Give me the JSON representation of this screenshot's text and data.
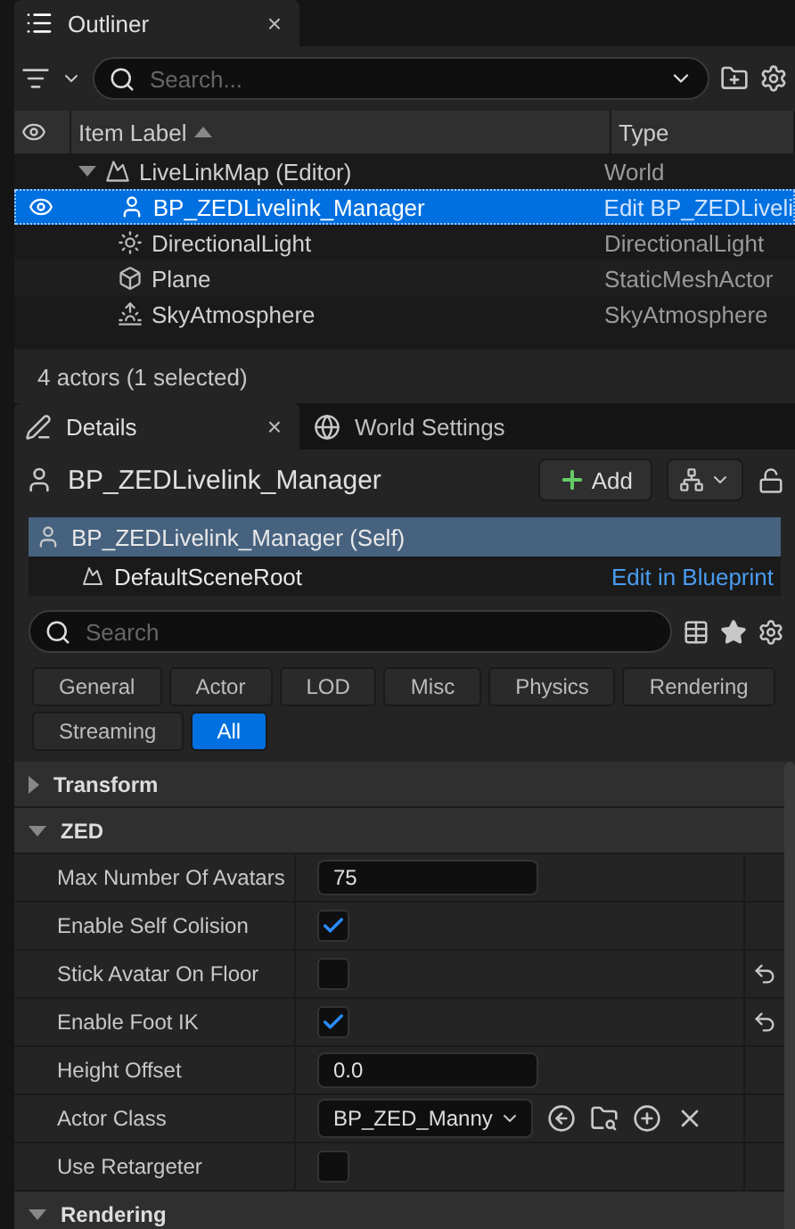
{
  "outliner": {
    "tab": {
      "title": "Outliner",
      "close": "×"
    },
    "search": {
      "placeholder": "Search..."
    },
    "columns": [
      {
        "label": "Item Label",
        "sorted": true
      },
      {
        "label": "Type",
        "sorted": false
      }
    ],
    "rows": [
      {
        "kind": "world",
        "label": "LiveLinkMap (Editor)",
        "type": "World",
        "expanded": true,
        "selected": false,
        "visible": false,
        "children": [
          {
            "kind": "actor",
            "label": "BP_ZEDLivelink_Manager",
            "type": "Edit BP_ZEDLiveli",
            "type_is_link": true,
            "selected": true,
            "visible": true
          },
          {
            "kind": "light",
            "label": "DirectionalLight",
            "type": "DirectionalLight",
            "type_is_link": false,
            "selected": false,
            "visible": false
          },
          {
            "kind": "mesh",
            "label": "Plane",
            "type": "StaticMeshActor",
            "type_is_link": false,
            "selected": false,
            "visible": false
          },
          {
            "kind": "sky",
            "label": "SkyAtmosphere",
            "type": "SkyAtmosphere",
            "type_is_link": false,
            "selected": false,
            "visible": false
          }
        ]
      }
    ],
    "footer": "4 actors (1 selected)"
  },
  "details": {
    "tabs": [
      {
        "kind": "details",
        "label": "Details",
        "close": "×",
        "selected": true
      },
      {
        "kind": "world",
        "label": "World Settings",
        "selected": false
      }
    ],
    "actor_name": "BP_ZEDLivelink_Manager",
    "add_button": "Add",
    "components": [
      {
        "label": "BP_ZEDLivelink_Manager (Self)",
        "selected": true
      },
      {
        "label": "DefaultSceneRoot",
        "action": "Edit in Blueprint",
        "selected": false
      }
    ],
    "search": {
      "placeholder": "Search"
    },
    "filters": [
      {
        "label": "General",
        "selected": false
      },
      {
        "label": "Actor",
        "selected": false
      },
      {
        "label": "LOD",
        "selected": false
      },
      {
        "label": "Misc",
        "selected": false
      },
      {
        "label": "Physics",
        "selected": false
      },
      {
        "label": "Rendering",
        "selected": false
      },
      {
        "label": "Streaming",
        "selected": false
      },
      {
        "label": "All",
        "selected": true
      }
    ],
    "categories": [
      {
        "name": "Transform",
        "expanded": false
      },
      {
        "name": "ZED",
        "expanded": true,
        "properties": [
          {
            "kind": "number",
            "label": "Max Number Of Avatars",
            "value": "75",
            "modified": false
          },
          {
            "kind": "checkbox",
            "label": "Enable Self Colision",
            "checked": true,
            "modified": false
          },
          {
            "kind": "checkbox",
            "label": "Stick Avatar On Floor",
            "checked": false,
            "modified": true
          },
          {
            "kind": "checkbox",
            "label": "Enable Foot IK",
            "checked": true,
            "modified": true
          },
          {
            "kind": "number",
            "label": "Height Offset",
            "value": "0.0",
            "modified": false
          },
          {
            "kind": "class",
            "label": "Actor Class",
            "value": "BP_ZED_Manny",
            "modified": false
          },
          {
            "kind": "checkbox",
            "label": "Use Retargeter",
            "checked": false,
            "modified": false
          }
        ]
      },
      {
        "name": "Rendering",
        "expanded": true
      }
    ]
  }
}
